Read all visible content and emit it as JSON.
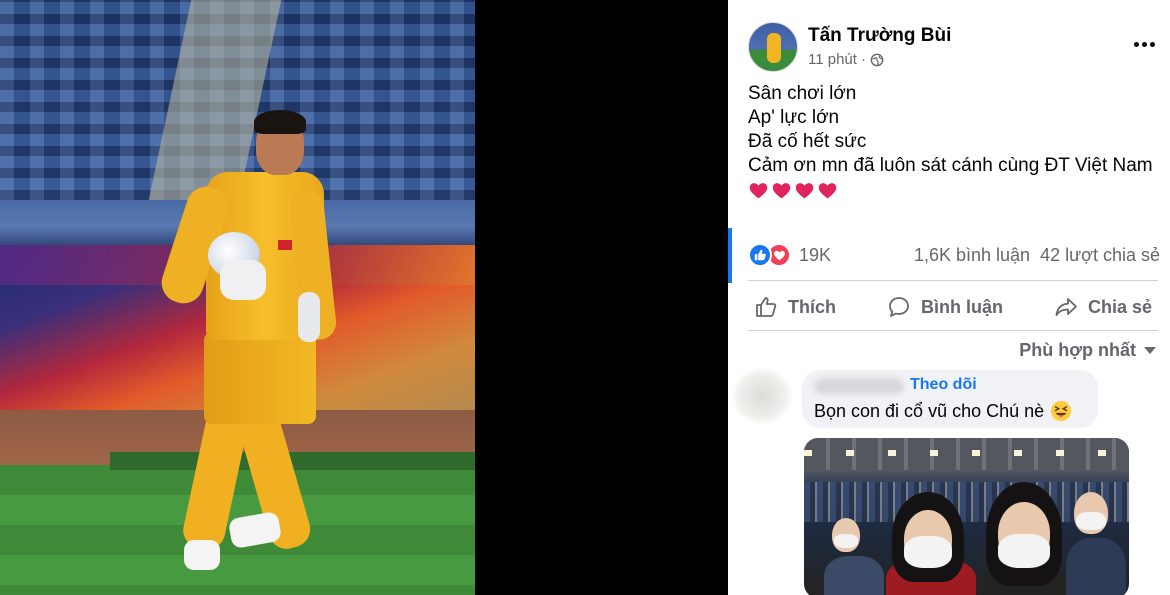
{
  "post": {
    "author": "Tấn Trường Bùi",
    "time": "11 phút",
    "separator": "·",
    "privacy_icon": "globe-icon",
    "lines": [
      "Sân chơi lớn",
      "Ap' lực lớn",
      "Đã cố hết sức",
      "Cảm ơn mn đã luôn sát cánh cùng ĐT Việt Nam"
    ],
    "heart_emoji_count": 4
  },
  "stats": {
    "reactions_count": "19K",
    "comments": "1,6K bình luận",
    "shares": "42 lượt chia sẻ"
  },
  "actions": {
    "like": "Thích",
    "comment": "Bình luận",
    "share": "Chia sẻ"
  },
  "sort": {
    "label": "Phù hợp nhất"
  },
  "comment": {
    "follow_label": "Theo dõi",
    "text": "Bọn con đi cổ vũ cho Chú nè",
    "emoji": "squinting-face-with-tongue-icon"
  },
  "colors": {
    "accent": "#1877f2",
    "love": "#f33e58",
    "text_secondary": "#65676b",
    "heart": "#e0245e"
  }
}
